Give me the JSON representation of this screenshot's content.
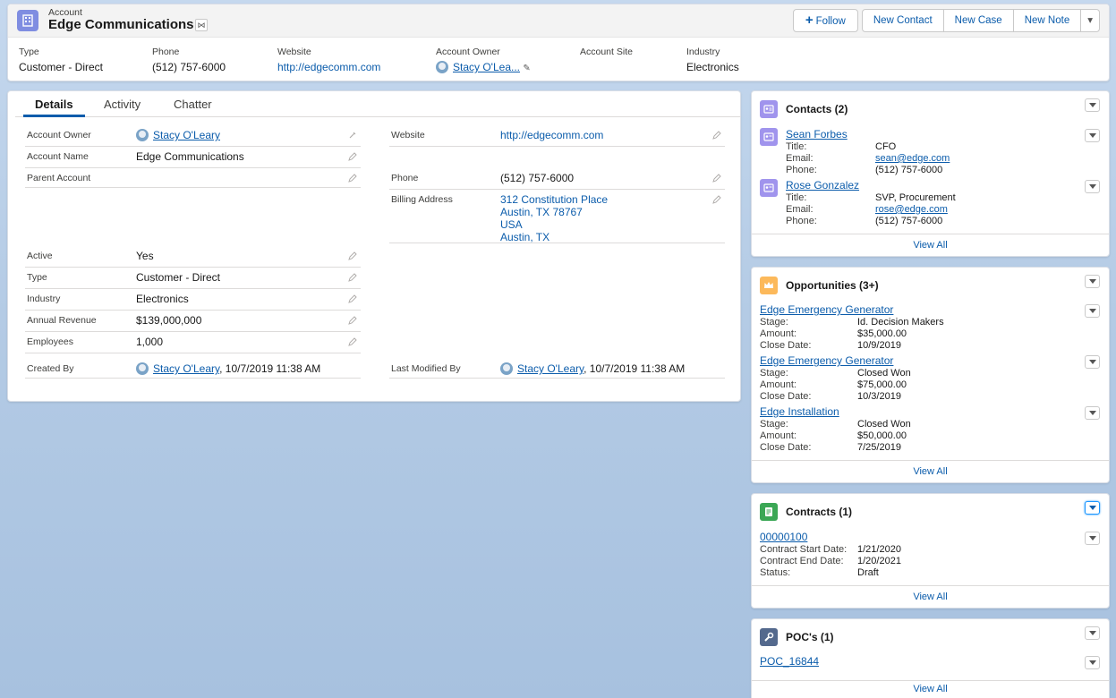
{
  "header": {
    "object_type": "Account",
    "record_name": "Edge Communications",
    "follow_label": "Follow",
    "actions": [
      "New Contact",
      "New Case",
      "New Note"
    ],
    "fields": [
      {
        "label": "Type",
        "value": "Customer - Direct"
      },
      {
        "label": "Phone",
        "value": "(512) 757-6000"
      },
      {
        "label": "Website",
        "value": "http://edgecomm.com"
      },
      {
        "label": "Account Owner",
        "value": "Stacy O'Lea..."
      },
      {
        "label": "Account Site",
        "value": ""
      },
      {
        "label": "Industry",
        "value": "Electronics"
      }
    ]
  },
  "tabs": [
    "Details",
    "Activity",
    "Chatter"
  ],
  "details": {
    "left": [
      {
        "label": "Account Owner",
        "value": "Stacy O'Leary"
      },
      {
        "label": "Account Name",
        "value": "Edge Communications"
      },
      {
        "label": "Parent Account",
        "value": ""
      },
      {
        "label": "Active",
        "value": "Yes"
      },
      {
        "label": "Type",
        "value": "Customer - Direct"
      },
      {
        "label": "Industry",
        "value": "Electronics"
      },
      {
        "label": "Annual Revenue",
        "value": "$139,000,000"
      },
      {
        "label": "Employees",
        "value": "1,000"
      }
    ],
    "right": [
      {
        "label": "Website",
        "value": "http://edgecomm.com"
      },
      {
        "label": "Phone",
        "value": "(512) 757-6000"
      },
      {
        "label": "Billing Address",
        "lines": [
          "312 Constitution Place",
          "Austin, TX 78767",
          "USA",
          "Austin, TX"
        ]
      }
    ],
    "created_by": {
      "label": "Created By",
      "user": "Stacy O'Leary",
      "timestamp": ", 10/7/2019 11:38 AM"
    },
    "last_modified_by": {
      "label": "Last Modified By",
      "user": "Stacy O'Leary",
      "timestamp": ", 10/7/2019 11:38 AM"
    }
  },
  "contacts": {
    "title": "Contacts (2)",
    "items": [
      {
        "name": "Sean Forbes",
        "title_label": "Title:",
        "title": "CFO",
        "email_label": "Email:",
        "email": "sean@edge.com",
        "phone_label": "Phone:",
        "phone": "(512) 757-6000"
      },
      {
        "name": "Rose Gonzalez",
        "title_label": "Title:",
        "title": "SVP, Procurement",
        "email_label": "Email:",
        "email": "rose@edge.com",
        "phone_label": "Phone:",
        "phone": "(512) 757-6000"
      }
    ],
    "view_all": "View All"
  },
  "opportunities": {
    "title": "Opportunities (3+)",
    "items": [
      {
        "name": "Edge Emergency Generator",
        "stage_label": "Stage:",
        "stage": "Id. Decision Makers",
        "amount_label": "Amount:",
        "amount": "$35,000.00",
        "close_label": "Close Date:",
        "close": "10/9/2019"
      },
      {
        "name": "Edge Emergency Generator",
        "stage_label": "Stage:",
        "stage": "Closed Won",
        "amount_label": "Amount:",
        "amount": "$75,000.00",
        "close_label": "Close Date:",
        "close": "10/3/2019"
      },
      {
        "name": "Edge Installation",
        "stage_label": "Stage:",
        "stage": "Closed Won",
        "amount_label": "Amount:",
        "amount": "$50,000.00",
        "close_label": "Close Date:",
        "close": "7/25/2019"
      }
    ],
    "view_all": "View All"
  },
  "contracts": {
    "title": "Contracts (1)",
    "items": [
      {
        "number": "00000100",
        "start_label": "Contract Start Date:",
        "start": "1/21/2020",
        "end_label": "Contract End Date:",
        "end": "1/20/2021",
        "status_label": "Status:",
        "status": "Draft"
      }
    ],
    "view_all": "View All"
  },
  "pocs": {
    "title": "POC's (1)",
    "items": [
      {
        "name": "POC_16844"
      }
    ],
    "view_all": "View All"
  },
  "colors": {
    "accent": "#0b5cab",
    "account_icon": "#7f8de1",
    "contact_icon": "#a094ed",
    "opportunity_icon": "#fcb95b",
    "contract_icon": "#3ba755",
    "poc_icon": "#54698d"
  },
  "icons": {
    "account": "building-icon",
    "hierarchy": "hierarchy-icon",
    "contacts": "contact-card-icon",
    "opportunities": "crown-icon",
    "contracts": "document-icon",
    "pocs": "wrench-icon",
    "edit": "pencil-icon",
    "owner_change": "user-change-icon"
  }
}
